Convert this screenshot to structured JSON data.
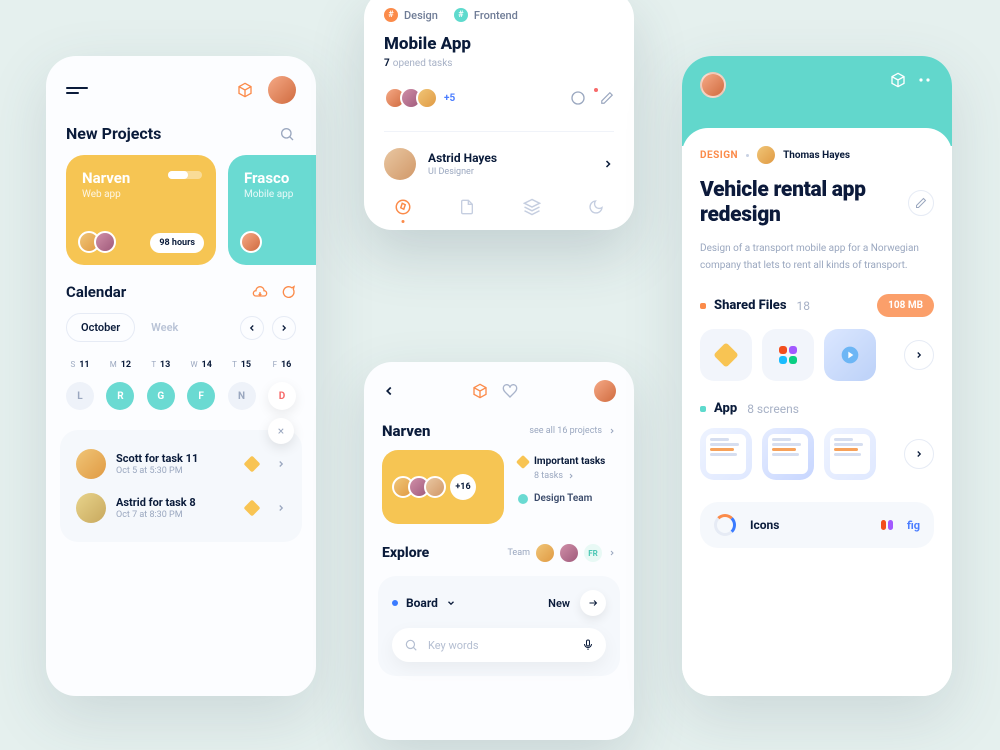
{
  "phone1": {
    "section_title": "New Projects",
    "cards": [
      {
        "name": "Narven",
        "subtitle": "Web app",
        "hours": "98 hours"
      },
      {
        "name": "Frasco",
        "subtitle": "Mobile app"
      }
    ],
    "calendar": {
      "title": "Calendar",
      "tab_month": "October",
      "tab_week": "Week",
      "days": [
        {
          "w": "S",
          "n": "11"
        },
        {
          "w": "M",
          "n": "12"
        },
        {
          "w": "T",
          "n": "13"
        },
        {
          "w": "W",
          "n": "14"
        },
        {
          "w": "T",
          "n": "15"
        },
        {
          "w": "F",
          "n": "16"
        }
      ],
      "dots": [
        "L",
        "R",
        "G",
        "F",
        "N",
        "D"
      ]
    },
    "tasks": [
      {
        "title": "Scott  for  task 11",
        "sub": "Oct 5 at 5:30 PM"
      },
      {
        "title": "Astrid  for  task 8",
        "sub": "Oct 7 at 8:30 PM"
      }
    ]
  },
  "mid_top": {
    "tag1": "Design",
    "tag2": "Frontend",
    "title": "Mobile App",
    "opened_count": "7",
    "opened_label": "opened tasks",
    "more_avatars": "+5",
    "person_name": "Astrid Hayes",
    "person_role": "UI Designer"
  },
  "mid_bottom": {
    "title": "Narven",
    "see_all": "see all 16 projects",
    "plus": "+16",
    "important": "Important tasks",
    "important_sub": "8 tasks",
    "team_label": "Design Team",
    "explore": "Explore",
    "team_word": "Team",
    "fr": "FR",
    "board": "Board",
    "new": "New",
    "search_placeholder": "Key words"
  },
  "phone3": {
    "crumb_design": "DESIGN",
    "crumb_name": "Thomas Hayes",
    "title": "Vehicle rental app redesign",
    "desc": "Design of a transport mobile app for a Norwegian company that lets to rent all kinds of transport.",
    "shared_title": "Shared Files",
    "shared_count": "18",
    "shared_badge": "108 MB",
    "app_title": "App",
    "app_count": "8 screens",
    "bottom_icons": "Icons",
    "bottom_fig": "fig"
  }
}
